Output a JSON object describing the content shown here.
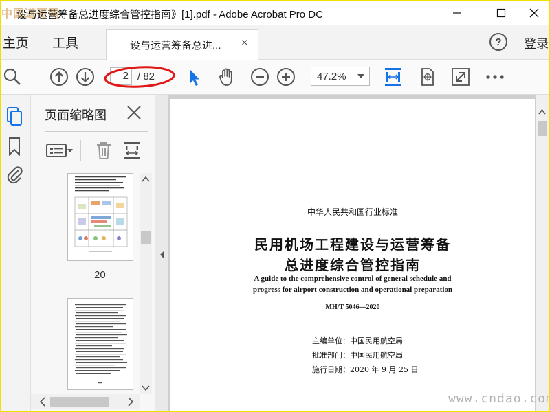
{
  "window": {
    "logo_text": "中国道哥网",
    "title": "设与运营筹备总进度综合管控指南》[1].pdf - Adobe Acrobat Pro DC"
  },
  "menu": {
    "home_label": "主页",
    "tools_label": "工具",
    "tab_label": "设与运营筹备总进...",
    "tab_close": "×",
    "help_glyph": "?",
    "login_label": "登录"
  },
  "toolbar": {
    "current_page": "2",
    "total_pages": "/ 82",
    "zoom": "47.2%",
    "annotation_color": "#e01818",
    "accent_color": "#1473e6"
  },
  "panel": {
    "title": "页面缩略图",
    "thumb_label_1": "20"
  },
  "document": {
    "std_header": "中华人民共和国行业标准",
    "title_line1": "民用机场工程建设与运营筹备",
    "title_line2": "总进度综合管控指南",
    "en_line1": "A guide to the comprehensive control of general schedule and",
    "en_line2": "progress for airport construction and operational preparation",
    "std_number": "MH/T 5046—2020",
    "issuer": "主编单位：中国民用航空局",
    "approver": "批准部门：中国民用航空局",
    "effective_date": "施行日期：2020 年 9 月 25 日"
  },
  "watermark": "www.cndao.com"
}
